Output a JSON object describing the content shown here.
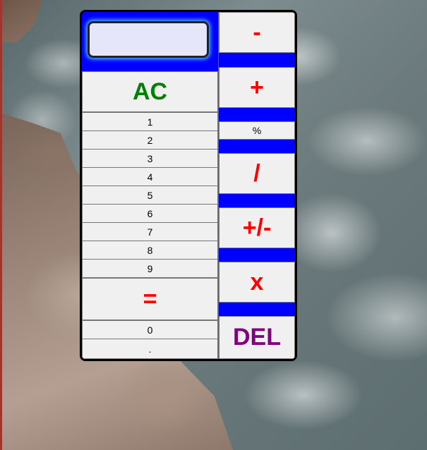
{
  "calculator": {
    "display_value": "",
    "clear_label": "AC",
    "digits": [
      "1",
      "2",
      "3",
      "4",
      "5",
      "6",
      "7",
      "8",
      "9"
    ],
    "equals_label": "=",
    "zero_label": "0",
    "decimal_label": ".",
    "operators": {
      "minus": "-",
      "plus": "+",
      "percent": "%",
      "divide": "/",
      "negate": "+/-",
      "multiply": "x",
      "delete": "DEL"
    }
  },
  "colors": {
    "frame_blue": "#0000ff",
    "display_bg": "#e6e6fa",
    "clear_green": "#008000",
    "operator_red": "#ff0000",
    "delete_purple": "#800080"
  }
}
